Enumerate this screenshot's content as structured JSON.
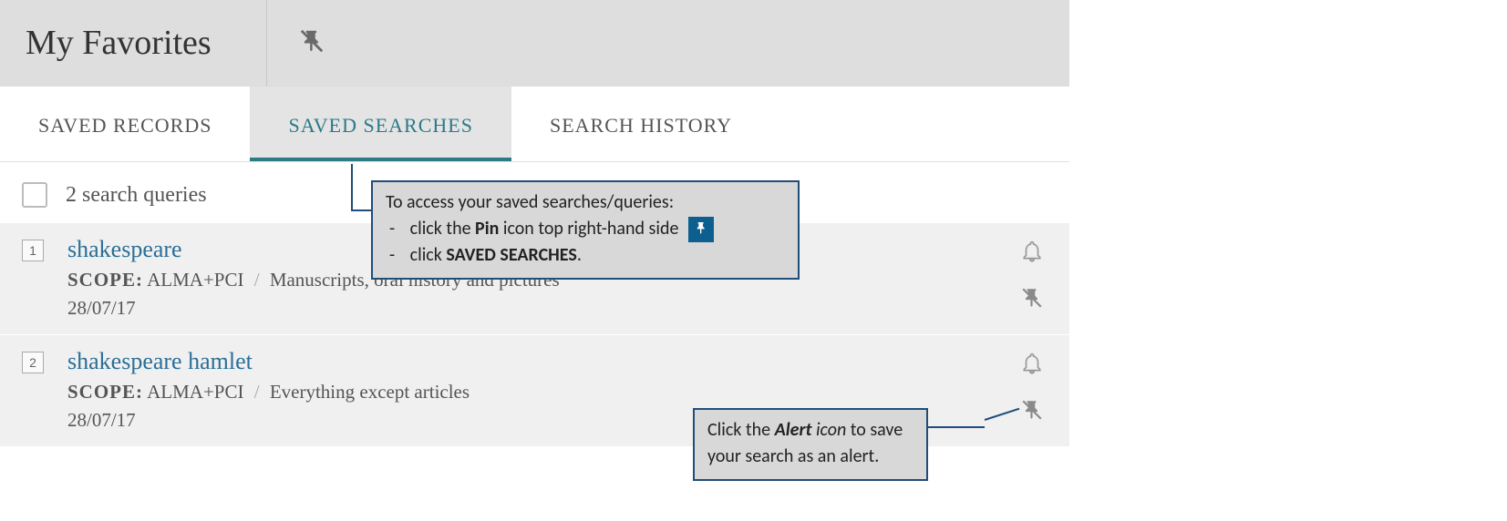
{
  "header": {
    "title": "My Favorites"
  },
  "tabs": {
    "saved_records": "SAVED RECORDS",
    "saved_searches": "SAVED SEARCHES",
    "search_history": "SEARCH HISTORY"
  },
  "queries": {
    "count_label": "2 search queries",
    "items": [
      {
        "num": "1",
        "title": "shakespeare",
        "scope_label": "SCOPE:",
        "scope_value": "ALMA+PCI",
        "filter": "Manuscripts, oral history and pictures",
        "date": "28/07/17"
      },
      {
        "num": "2",
        "title": "shakespeare hamlet",
        "scope_label": "SCOPE:",
        "scope_value": "ALMA+PCI",
        "filter": "Everything except articles",
        "date": "28/07/17"
      }
    ]
  },
  "callouts": {
    "top": {
      "intro": "To access your saved searches/queries:",
      "li1_a": "click the ",
      "li1_b": "Pin",
      "li1_c": " icon top right-hand side",
      "li2_a": "click ",
      "li2_b": "SAVED SEARCHES",
      "li2_c": "."
    },
    "alert": {
      "a": "Click the ",
      "b": "Alert",
      "c": " icon",
      "d": " to save your search as an alert."
    }
  }
}
